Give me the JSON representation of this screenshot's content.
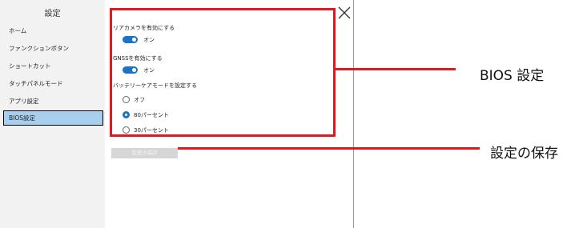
{
  "sidebar": {
    "title": "設定",
    "items": [
      {
        "label": "ホーム"
      },
      {
        "label": "ファンクションボタン"
      },
      {
        "label": "ショートカット"
      },
      {
        "label": "タッチパネルモード"
      },
      {
        "label": "アプリ設定"
      },
      {
        "label": "BIOS設定"
      }
    ]
  },
  "settings": {
    "rear_camera": {
      "label": "リアカメラを有効にする",
      "state": "オン"
    },
    "gnss": {
      "label": "GNSSを有効にする",
      "state": "オン"
    },
    "battery": {
      "label": "バッテリーケアモードを設定する",
      "options": [
        {
          "label": "オフ"
        },
        {
          "label": "80パーセント"
        },
        {
          "label": "30パーセント"
        }
      ],
      "selected": "80パーセント"
    },
    "save_button": "変更の保存"
  },
  "annotations": {
    "bios_callout": "BIOS 設定",
    "save_callout": "設定の保存"
  },
  "colors": {
    "highlight": "#e5161d",
    "accent": "#1a73c8",
    "active_item": "#a9cfee"
  }
}
